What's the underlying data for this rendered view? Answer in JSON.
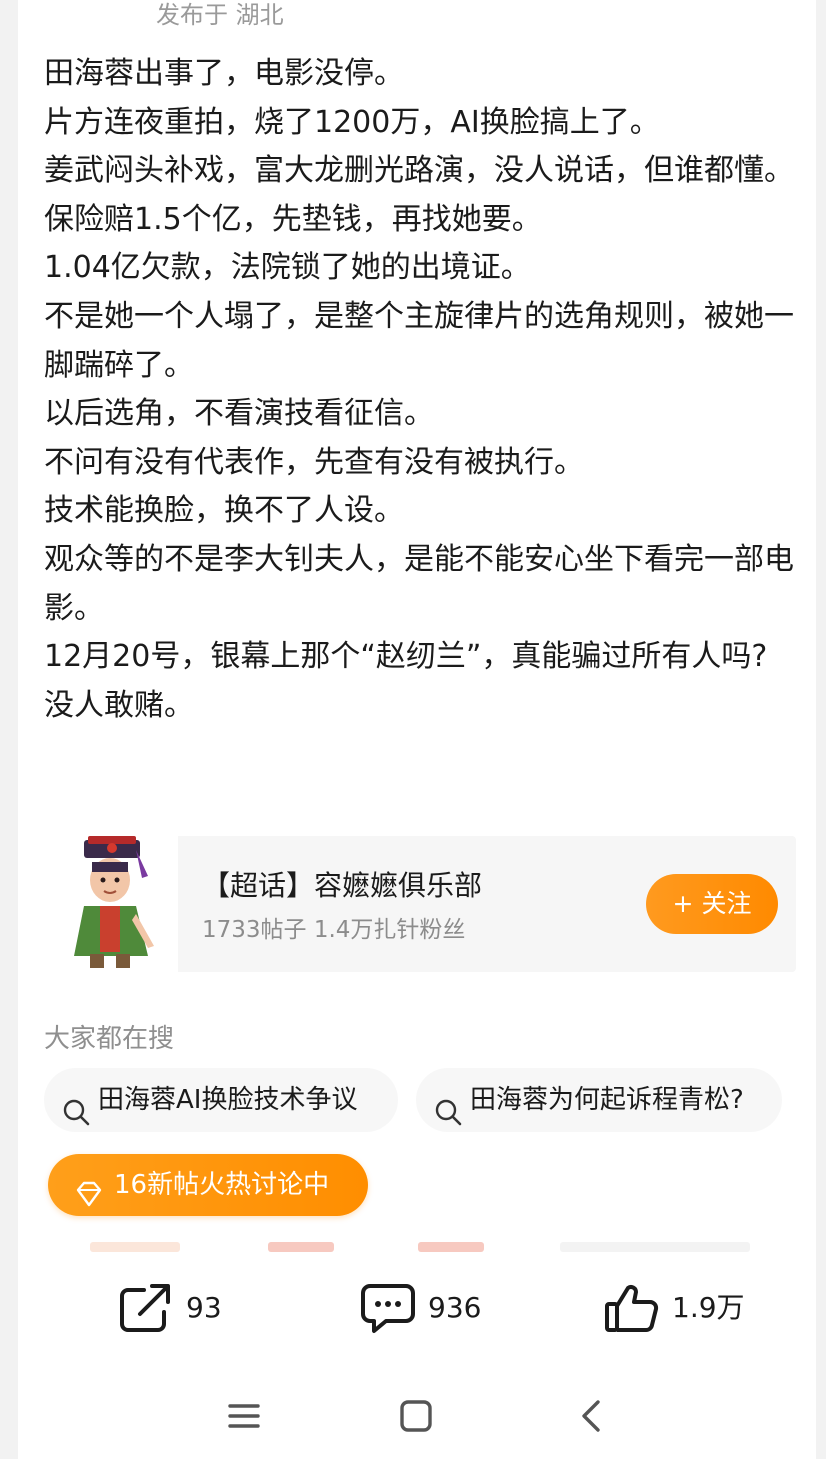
{
  "post_meta": {
    "location": "发布于 湖北"
  },
  "post_lines": [
    "田海蓉出事了，电影没停。",
    "片方连夜重拍，烧了1200万，AI换脸搞上了。",
    "姜武闷头补戏，富大龙删光路演，没人说话，但谁都懂。",
    "保险赔1.5个亿，先垫钱，再找她要。",
    "1.04亿欠款，法院锁了她的出境证。",
    "不是她一个人塌了，是整个主旋律片的选角规则，被她一脚踹碎了。",
    "以后选角，不看演技看征信。",
    "不问有没有代表作，先查有没有被执行。",
    "技术能换脸，换不了人设。",
    "观众等的不是李大钊夫人，是能不能安心坐下看完一部电影。",
    "12月20号，银幕上那个“赵纫兰”，真能骗过所有人吗?",
    "没人敢赌。"
  ],
  "topic": {
    "title": "【超话】容嬷嬷俱乐部",
    "stats": "1733帖子 1.4万扎针粉丝",
    "follow_label": "+ 关注",
    "avatar_icon": "cartoon-avatar-icon"
  },
  "search": {
    "heading": "大家都在搜",
    "chips": [
      "田海蓉AI换脸技术争议",
      "田海蓉为何起诉程青松?"
    ]
  },
  "hot_pill": {
    "label": "16新帖火热讨论中",
    "icon": "diamond-icon"
  },
  "actions": {
    "share_count": "93",
    "comment_count": "936",
    "like_count": "1.9万"
  },
  "colors": {
    "accent": "#ff8a00",
    "muted": "#9a9a9a"
  }
}
